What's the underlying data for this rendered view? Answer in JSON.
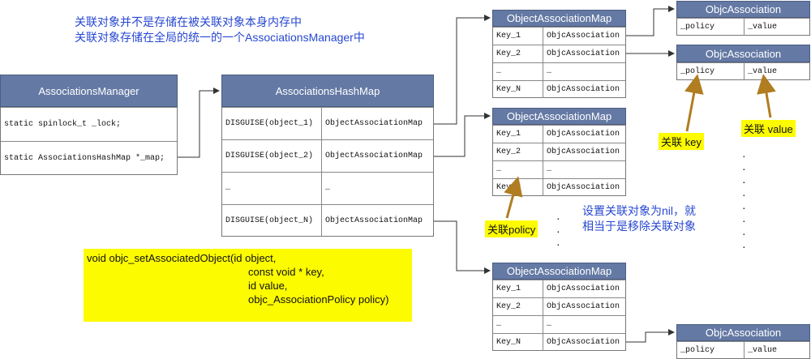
{
  "notes": {
    "line1": "关联对象并不是存储在被关联对象本身内存中",
    "line2": "关联对象存储在全局的统一的一个AssociationsManager中",
    "nil_line1": "设置关联对象为nil，就",
    "nil_line2": "相当于是移除关联对象"
  },
  "manager": {
    "title": "AssociationsManager",
    "rows": [
      "static spinlock_t _lock;",
      "static AssociationsHashMap *_map;"
    ]
  },
  "hashmap": {
    "title": "AssociationsHashMap",
    "rows": [
      [
        "DISGUISE(object_1)",
        "ObjectAssociationMap"
      ],
      [
        "DISGUISE(object_2)",
        "ObjectAssociationMap"
      ],
      [
        "…",
        "…"
      ],
      [
        "DISGUISE(object_N)",
        "ObjectAssociationMap"
      ]
    ]
  },
  "oam1": {
    "title": "ObjectAssociationMap",
    "rows": [
      [
        "Key_1",
        "ObjcAssociation"
      ],
      [
        "Key_2",
        "ObjcAssociation"
      ],
      [
        "…",
        "…"
      ],
      [
        "Key_N",
        "ObjcAssociation"
      ]
    ]
  },
  "oam2": {
    "title": "ObjectAssociationMap",
    "rows": [
      [
        "Key_1",
        "ObjcAssociation"
      ],
      [
        "Key_2",
        "ObjcAssociation"
      ],
      [
        "…",
        "…"
      ],
      [
        "Key_N",
        "ObjcAssociation"
      ]
    ]
  },
  "oam3": {
    "title": "ObjectAssociationMap",
    "rows": [
      [
        "Key_1",
        "ObjcAssociation"
      ],
      [
        "Key_2",
        "ObjcAssociation"
      ],
      [
        "…",
        "…"
      ],
      [
        "Key_N",
        "ObjcAssociation"
      ]
    ]
  },
  "assoc1": {
    "title": "ObjcAssociation",
    "cells": [
      "_policy",
      "_value"
    ]
  },
  "assoc2": {
    "title": "ObjcAssociation",
    "cells": [
      "_policy",
      "_value"
    ]
  },
  "assoc3": {
    "title": "ObjcAssociation",
    "cells": [
      "_policy",
      "_value"
    ]
  },
  "labels": {
    "key": "关联 key",
    "value": "关联 value",
    "policy": "关联policy"
  },
  "code": {
    "line1": "void objc_setAssociatedObject(id object,",
    "line2": "const void * key,",
    "line3": "id value,",
    "line4": "objc_AssociationPolicy policy)"
  },
  "dots": "·",
  "colors": {
    "header": "#6479a4",
    "highlight": "#fdfb00",
    "note": "#2747d1",
    "arrow": "#b07d20"
  }
}
